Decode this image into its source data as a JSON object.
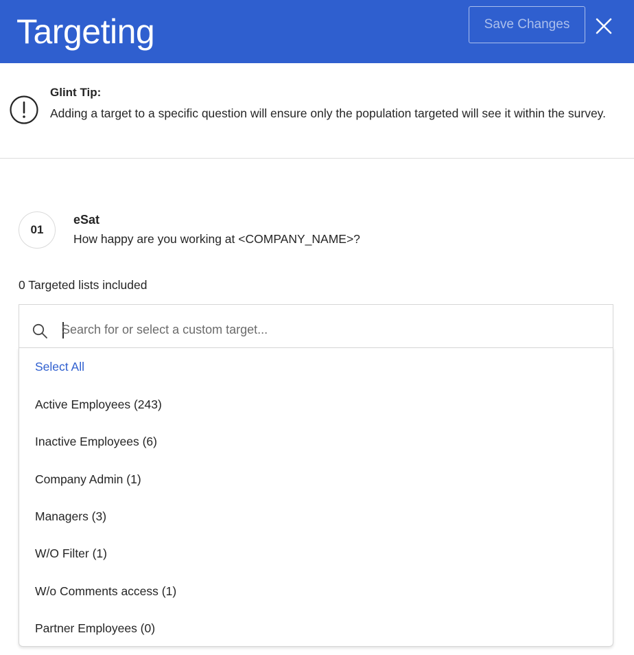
{
  "header": {
    "title": "Targeting",
    "save_label": "Save Changes"
  },
  "tip": {
    "title": "Glint Tip:",
    "text": "Adding a target to a specific question will ensure only the population targeted will see it within the survey."
  },
  "question": {
    "number": "01",
    "title": "eSat",
    "text": "How happy are you working at <COMPANY_NAME>?"
  },
  "targeted_lists": {
    "count_label": "0 Targeted lists included"
  },
  "search": {
    "placeholder": "Search for or select a custom target...",
    "value": ""
  },
  "dropdown": {
    "select_all": "Select All",
    "items": [
      "Active Employees (243)",
      "Inactive Employees (6)",
      "Company Admin (1)",
      "Managers (3)",
      "W/O Filter (1)",
      "W/o Comments access (1)",
      "Partner Employees (0)"
    ]
  },
  "colors": {
    "header_bg": "#2f5fcf",
    "accent": "#2f5fcf"
  },
  "icons": {
    "close": "close-icon",
    "tip": "exclamation-circle-icon",
    "search": "search-icon"
  }
}
